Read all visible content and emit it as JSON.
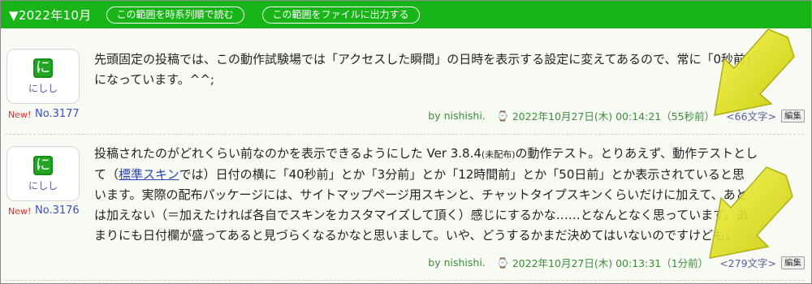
{
  "header": {
    "title": "▼2022年10月",
    "buttons": [
      "この範囲を時系列順で読む",
      "この範囲をファイルに出力する"
    ]
  },
  "posts": [
    {
      "avatar_glyph": "に",
      "author": "にしし",
      "new_tag": "New!",
      "number": "No.3177",
      "body_lines": [
        "先頭固定の投稿では、この動作試験場では「アクセスした瞬間」の日時を表示する設定に変えてあるので、常に「0秒前」",
        "になっています。^^;"
      ],
      "by": "by nishishi.",
      "clock_icon": "clock-icon",
      "datetime": "2022年10月27日(木) 00:14:21（55秒前）",
      "chars": "<66文字>",
      "edit_label": "編集"
    },
    {
      "avatar_glyph": "に",
      "author": "にしし",
      "new_tag": "New!",
      "number": "No.3176",
      "body": {
        "l1a": "投稿されたのがどれくらい前なのかを表示できるようにした Ver 3.8.4",
        "l1b": "(未配布)",
        "l1c": "の動作テスト。とりあえず、動作テストとし",
        "l2a": "て（",
        "l2link": "標準スキン",
        "l2b": "では）日付の横に「40秒前」とか「3分前」とか「12時間前」とか「50日前」とか表示されていると思",
        "l3": "います。実際の配布パッケージには、サイトマップページ用スキンと、チャットタイプスキンくらいだけに加えて、あと",
        "l4": "は加えない（＝加えたければ各自でスキンをカスタマイズして頂く）感じにするかな……となんとなく思っています。あ",
        "l5": "まりにも日付欄が盛ってあると見づらくなるかなと思いまして。いや、どうするかまだ決めてはいないのですけども。"
      },
      "by": "by nishishi.",
      "clock_icon": "clock-icon",
      "datetime": "2022年10月27日(木) 00:13:31（1分前）",
      "chars": "<279文字>",
      "edit_label": "編集"
    }
  ],
  "colors": {
    "header_bg": "#18b418",
    "arrow": "#e6e600",
    "link": "#2a42b8"
  }
}
